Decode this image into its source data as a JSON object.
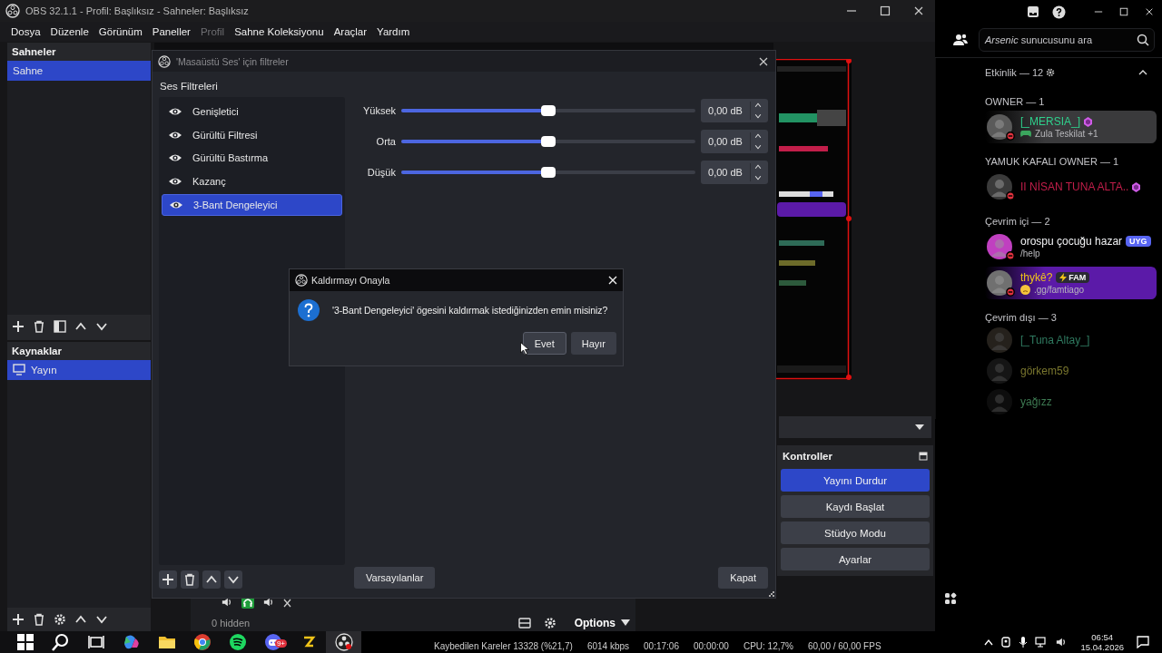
{
  "obs": {
    "title": "OBS 32.1.1 - Profil: Başlıksız - Sahneler: Başlıksız",
    "menu": [
      {
        "label": "Dosya",
        "disabled": false
      },
      {
        "label": "Düzenle",
        "disabled": false
      },
      {
        "label": "Görünüm",
        "disabled": false
      },
      {
        "label": "Paneller",
        "disabled": false
      },
      {
        "label": "Profil",
        "disabled": true
      },
      {
        "label": "Sahne Koleksiyonu",
        "disabled": false
      },
      {
        "label": "Araçlar",
        "disabled": false
      },
      {
        "label": "Yardım",
        "disabled": false
      }
    ],
    "scenes": {
      "title": "Sahneler",
      "items": [
        {
          "label": "Sahne",
          "selected": true
        }
      ]
    },
    "sources": {
      "title": "Kaynaklar",
      "items": [
        {
          "label": "Yayın",
          "selected": true
        }
      ]
    },
    "controls": {
      "title": "Kontroller",
      "buttons": [
        {
          "label": "Yayını Durdur",
          "selected": true
        },
        {
          "label": "Kaydı Başlat",
          "selected": false
        },
        {
          "label": "Stüdyo Modu",
          "selected": false
        },
        {
          "label": "Ayarlar",
          "selected": false
        }
      ]
    },
    "mixer": {
      "hidden": "0 hidden",
      "options": "Options"
    },
    "status_bar": [
      "Kaybedilen Kareler 13328 (%21,7)",
      "6014 kbps",
      "00:17:06",
      "00:00:00",
      "CPU: 12,7%",
      "60,00 / 60,00 FPS"
    ]
  },
  "filters_dialog": {
    "title": "'Masaüstü Ses' için filtreler",
    "section": "Ses Filtreleri",
    "filters": [
      {
        "label": "Genişletici",
        "selected": false
      },
      {
        "label": "Gürültü Filtresi",
        "selected": false
      },
      {
        "label": "Gürültü Bastırma",
        "selected": false
      },
      {
        "label": "Kazanç",
        "selected": false
      },
      {
        "label": "3-Bant Dengeleyici",
        "selected": true
      }
    ],
    "bands": [
      {
        "label": "Yüksek",
        "level": 0.5,
        "value": "0,00 dB"
      },
      {
        "label": "Orta",
        "level": 0.5,
        "value": "0,00 dB"
      },
      {
        "label": "Düşük",
        "level": 0.5,
        "value": "0,00 dB"
      }
    ],
    "defaults_button": "Varsayılanlar",
    "close_button": "Kapat"
  },
  "confirm_dialog": {
    "title": "Kaldırmayı Onayla",
    "message": "'3-Bant Dengeleyici' ögesini kaldırmak istediğinizden emin misiniz?",
    "buttons": [
      "Evet",
      "Hayır"
    ]
  },
  "discord": {
    "search": {
      "placeholder": "*Arsenic* sunucusunu ara"
    },
    "activity": "Etkinlik — 12",
    "groups": [
      {
        "title": "OWNER — 1",
        "members": [
          {
            "name": "[_MERSIA_]",
            "color": "#2fd08c",
            "status": {
              "kind": "game",
              "text": "Zula Teskilat +1"
            },
            "banner": {
              "color": "#3a3a3c"
            },
            "boost": true,
            "dnd": true,
            "offline": false
          }
        ]
      },
      {
        "title": "YAMUK KAFALI OWNER — 1",
        "members": [
          {
            "name": "II NİSAN TUNA ALTA..",
            "color": "#c21e4a",
            "boost": true,
            "dnd": true,
            "offline": false
          }
        ]
      },
      {
        "title": "Çevrim içi — 2",
        "members": [
          {
            "name": "orospu çocuğu hazar",
            "color": "#f2f3f5",
            "tag": "UYG",
            "status": {
              "kind": "plain",
              "text": "/help"
            },
            "boost": false,
            "dnd": true,
            "offline": false
          },
          {
            "name": "thykê?",
            "color": "#f0c419",
            "tag": "FAM",
            "status": {
              "kind": "emoji",
              "text": ".gg/famtiago"
            },
            "banner": {
              "color": "#5b1aa8"
            },
            "boost": false,
            "dnd": true,
            "offline": false
          }
        ]
      },
      {
        "title": "Çevrim dışı — 3",
        "members": [
          {
            "name": "[_Tuna Altay_]",
            "color": "#2f7a60",
            "boost": false,
            "dnd": false,
            "offline": true
          },
          {
            "name": "görkem59",
            "color": "#7a772e",
            "boost": false,
            "dnd": false,
            "offline": true
          },
          {
            "name": "yağızz",
            "color": "#3d7a52",
            "boost": false,
            "dnd": false,
            "offline": true
          }
        ]
      }
    ]
  },
  "taskbar": {
    "badge": "9+",
    "time": "06:54",
    "date": "15.04.2026"
  }
}
